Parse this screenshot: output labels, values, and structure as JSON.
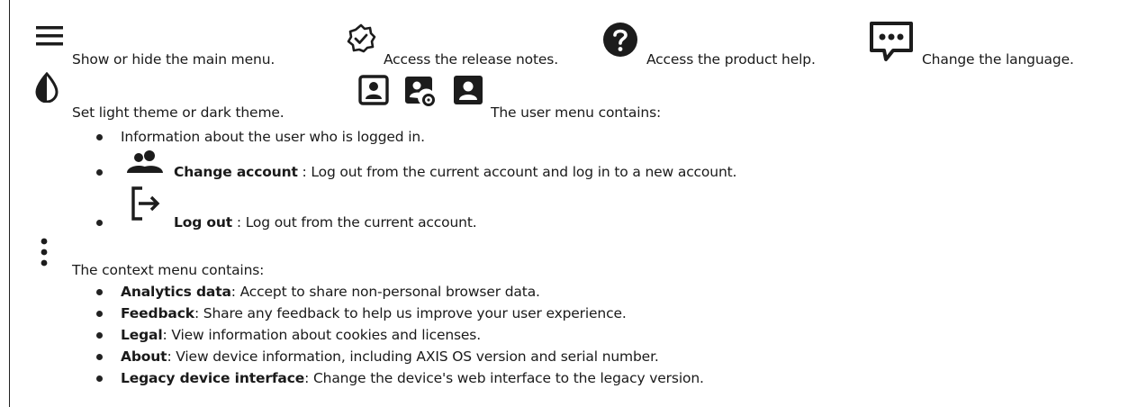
{
  "row1": {
    "menu_icon": "hamburger-menu-icon",
    "menu_text": "Show or hide the main menu.",
    "release_icon": "release-notes-badge-icon",
    "release_text": "Access the release notes.",
    "help_icon": "help-circle-icon",
    "help_text": "Access the product help.",
    "lang_icon": "chat-bubble-language-icon",
    "lang_text": "Change the language."
  },
  "row2": {
    "theme_icon": "theme-contrast-icon",
    "theme_text": "Set light theme or dark theme.",
    "user_icons": [
      "user-account-outline-icon",
      "user-settings-icon",
      "user-solid-icon"
    ],
    "user_menu_text": "The user menu contains:"
  },
  "user_menu": {
    "items": [
      {
        "text": "Information about the user who is logged in."
      },
      {
        "icon": "change-account-icon",
        "bold": "Change account",
        "text": " : Log out from the current account and log in to a new account."
      },
      {
        "icon": "log-out-icon",
        "bold": "Log out",
        "text": " : Log out from the current account."
      }
    ]
  },
  "context": {
    "icon": "kebab-menu-icon",
    "intro": "The context menu contains:",
    "items": [
      {
        "bold": "Analytics data",
        "text": ": Accept to share non-personal browser data."
      },
      {
        "bold": "Feedback",
        "text": ": Share any feedback to help us improve your user experience."
      },
      {
        "bold": "Legal",
        "text": ": View information about cookies and licenses."
      },
      {
        "bold": "About",
        "text": ": View device information, including AXIS OS version and serial number."
      },
      {
        "bold": "Legacy device interface",
        "text": ": Change the device's web interface to the legacy version."
      }
    ]
  },
  "colors": {
    "ink": "#1a1a1a",
    "icon": "#1c1c1c"
  }
}
